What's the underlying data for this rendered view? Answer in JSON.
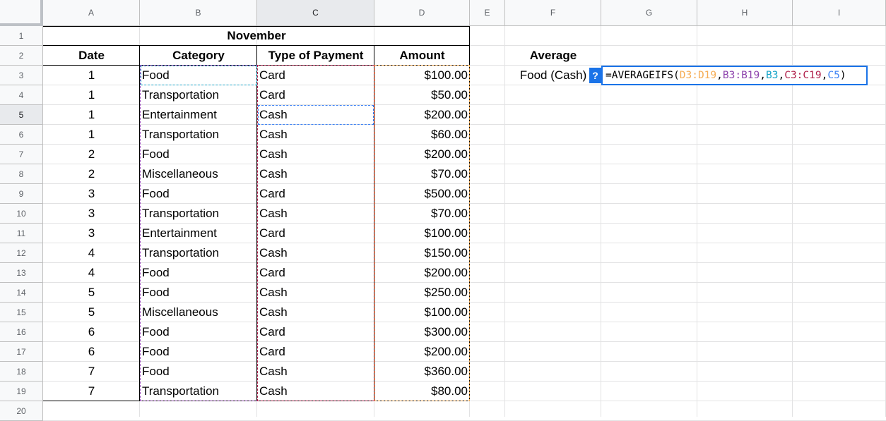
{
  "columns": [
    "A",
    "B",
    "C",
    "D",
    "E",
    "F",
    "G",
    "H",
    "I"
  ],
  "rows": [
    "1",
    "2",
    "3",
    "4",
    "5",
    "6",
    "7",
    "8",
    "9",
    "10",
    "11",
    "12",
    "13",
    "14",
    "15",
    "16",
    "17",
    "18",
    "19",
    "20"
  ],
  "title": "November",
  "headers": {
    "date": "Date",
    "category": "Category",
    "payment": "Type of Payment",
    "amount": "Amount"
  },
  "data": [
    {
      "date": "1",
      "category": "Food",
      "payment": "Card",
      "amount": "$100.00"
    },
    {
      "date": "1",
      "category": "Transportation",
      "payment": "Card",
      "amount": "$50.00"
    },
    {
      "date": "1",
      "category": "Entertainment",
      "payment": "Cash",
      "amount": "$200.00"
    },
    {
      "date": "1",
      "category": "Transportation",
      "payment": "Cash",
      "amount": "$60.00"
    },
    {
      "date": "2",
      "category": "Food",
      "payment": "Cash",
      "amount": "$200.00"
    },
    {
      "date": "2",
      "category": "Miscellaneous",
      "payment": "Cash",
      "amount": "$70.00"
    },
    {
      "date": "3",
      "category": "Food",
      "payment": "Card",
      "amount": "$500.00"
    },
    {
      "date": "3",
      "category": "Transportation",
      "payment": "Cash",
      "amount": "$70.00"
    },
    {
      "date": "3",
      "category": "Entertainment",
      "payment": "Card",
      "amount": "$100.00"
    },
    {
      "date": "4",
      "category": "Transportation",
      "payment": "Cash",
      "amount": "$150.00"
    },
    {
      "date": "4",
      "category": "Food",
      "payment": "Card",
      "amount": "$200.00"
    },
    {
      "date": "5",
      "category": "Food",
      "payment": "Cash",
      "amount": "$250.00"
    },
    {
      "date": "5",
      "category": "Miscellaneous",
      "payment": "Cash",
      "amount": "$100.00"
    },
    {
      "date": "6",
      "category": "Food",
      "payment": "Card",
      "amount": "$300.00"
    },
    {
      "date": "6",
      "category": "Food",
      "payment": "Card",
      "amount": "$200.00"
    },
    {
      "date": "7",
      "category": "Food",
      "payment": "Cash",
      "amount": "$360.00"
    },
    {
      "date": "7",
      "category": "Transportation",
      "payment": "Cash",
      "amount": "$80.00"
    }
  ],
  "average": {
    "label": "Average",
    "sublabel": "Food (Cash)"
  },
  "formula": {
    "help": "?",
    "parts": [
      {
        "text": "=AVERAGEIFS",
        "color": "#000000"
      },
      {
        "text": "(",
        "color": "#000000"
      },
      {
        "text": "D3:D19",
        "color": "#f6ad55"
      },
      {
        "text": ",",
        "color": "#000000"
      },
      {
        "text": "B3:B19",
        "color": "#8e44ad"
      },
      {
        "text": ",",
        "color": "#000000"
      },
      {
        "text": "B3",
        "color": "#14a3c7"
      },
      {
        "text": ",",
        "color": "#000000"
      },
      {
        "text": "C3:C19",
        "color": "#b0204a"
      },
      {
        "text": ",",
        "color": "#000000"
      },
      {
        "text": "C5",
        "color": "#4285f4"
      },
      {
        "text": ")",
        "color": "#000000"
      }
    ]
  },
  "colors": {
    "orange": "#f6ad55",
    "purple": "#8e44ad",
    "teal": "#14a3c7",
    "crimson": "#b0204a",
    "blue": "#4285f4"
  }
}
